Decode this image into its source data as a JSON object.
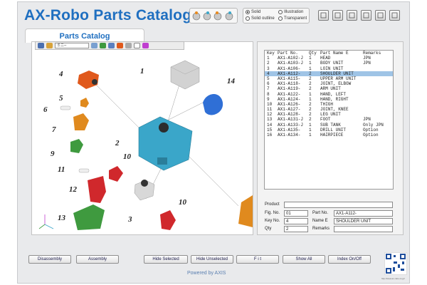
{
  "app": {
    "title": "AX-Robo Parts Catalog",
    "tab_label": "Parts Catalog",
    "powered_by": "Powered by AXIS",
    "qr_url": "http://www.ax-robo.co.jp/"
  },
  "display_modes": [
    {
      "label": "Solid",
      "selected": true
    },
    {
      "label": "Solid outline",
      "selected": false
    },
    {
      "label": "Illustration",
      "selected": false
    },
    {
      "label": "Transparent",
      "selected": false
    }
  ],
  "viewer_toolbar": {
    "select_value": "ミニ--"
  },
  "parts_list": {
    "headers": [
      "Key",
      "Part No.",
      "Qty",
      "Part Name E",
      "Remarks"
    ],
    "rows": [
      {
        "key": "1",
        "part": "AX1-A102-J",
        "qty": "1",
        "name": "HEAD",
        "remarks": "JPN"
      },
      {
        "key": "2",
        "part": "AX1-A103-J",
        "qty": "1",
        "name": "BODY UNIT",
        "remarks": "JPN"
      },
      {
        "key": "3",
        "part": "AX1-A106-",
        "qty": "1",
        "name": "LOIN UNIT",
        "remarks": ""
      },
      {
        "key": "4",
        "part": "AX1-A112-",
        "qty": "2",
        "name": "SHOULDER UNIT",
        "remarks": "",
        "selected": true
      },
      {
        "key": "5",
        "part": "AX1-A115-",
        "qty": "2",
        "name": "UPPER ARM UNIT",
        "remarks": ""
      },
      {
        "key": "6",
        "part": "AX1-A118-",
        "qty": "2",
        "name": "JOINT, ELBOW",
        "remarks": ""
      },
      {
        "key": "7",
        "part": "AX1-A119-",
        "qty": "2",
        "name": "ARM UNIT",
        "remarks": ""
      },
      {
        "key": "8",
        "part": "AX1-A122-",
        "qty": "1",
        "name": "HAND, LEFT",
        "remarks": ""
      },
      {
        "key": "9",
        "part": "AX1-A124-",
        "qty": "1",
        "name": "HAND, RIGHT",
        "remarks": ""
      },
      {
        "key": "10",
        "part": "AX1-A126-",
        "qty": "2",
        "name": "THIGH",
        "remarks": ""
      },
      {
        "key": "11",
        "part": "AX1-A127-",
        "qty": "2",
        "name": "JOINT, KNEE",
        "remarks": ""
      },
      {
        "key": "12",
        "part": "AX1-A128-",
        "qty": "2",
        "name": "LEG UNIT",
        "remarks": ""
      },
      {
        "key": "13",
        "part": "AX1-A131-J",
        "qty": "2",
        "name": "FOOT",
        "remarks": "JPN"
      },
      {
        "key": "14",
        "part": "AX1-A133-J",
        "qty": "1",
        "name": "SUB TANK",
        "remarks": "Only JPN"
      },
      {
        "key": "15",
        "part": "AX1-A135-",
        "qty": "1",
        "name": "DRILL UNIT",
        "remarks": "Option"
      },
      {
        "key": "16",
        "part": "AX1-A134-",
        "qty": "1",
        "name": "HAIRPIECE",
        "remarks": "Option"
      }
    ]
  },
  "detail": {
    "product_label": "Product",
    "product_value": "",
    "fig_label": "Fig. No.",
    "fig_value": "01",
    "key_label": "Key No.",
    "key_value": "4",
    "qty_label": "Qty",
    "qty_value": "2",
    "partno_label": "Part No.",
    "partno_value": "AX1-A112-",
    "name_label": "Name E",
    "name_value": "SHOULDER UNIT",
    "remarks_label": "Remarks",
    "remarks_value": ""
  },
  "buttons": {
    "disassembly": "Disassembly",
    "assembly": "Assembly",
    "hide_selected": "Hide Selected",
    "hide_unselected": "Hide Unselected",
    "fit": "F i t",
    "show_all": "Show All",
    "index_toggle": "Index On/Off"
  },
  "callouts": [
    "1",
    "2",
    "3",
    "4",
    "5",
    "6",
    "7",
    "9",
    "10",
    "11",
    "12",
    "13",
    "14",
    "10"
  ],
  "colors": {
    "title": "#1f6fc0",
    "selected_row": "#9fc4e6",
    "body_unit": "#3aa6c9",
    "head": "#cfcfcf",
    "shoulder": "#e0591c",
    "arm": "#e08a1e",
    "hand": "#3f9a3f",
    "leg": "#d0282c",
    "subtank": "#2f6fd6"
  }
}
